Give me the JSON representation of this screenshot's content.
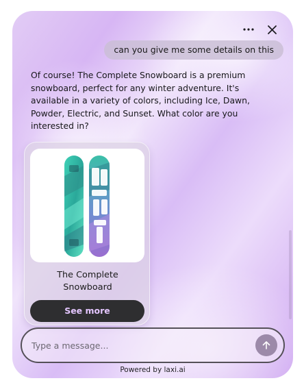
{
  "header": {
    "more_icon": "more-horizontal-icon",
    "close_icon": "close-icon"
  },
  "conversation": {
    "user_message": "can you give me some details on this",
    "bot_message": "Of course! The Complete Snowboard is a premium snowboard, perfect for any winter adventure. It's available in a variety of colors, including Ice, Dawn, Powder, Electric, and Sunset.  What color are you interested in?"
  },
  "product_card": {
    "title": "The Complete Snowboard",
    "button_label": "See more",
    "image_icon": "snowboard-image"
  },
  "composer": {
    "placeholder": "Type a message...",
    "send_icon": "arrow-up-icon"
  },
  "footer": {
    "powered_by": "Powered by laxi.ai"
  },
  "colors": {
    "button_bg": "#2e2e30",
    "button_text": "#e4c6ff",
    "send_button": "#9c8aa9",
    "user_bubble": "#cabed6"
  }
}
